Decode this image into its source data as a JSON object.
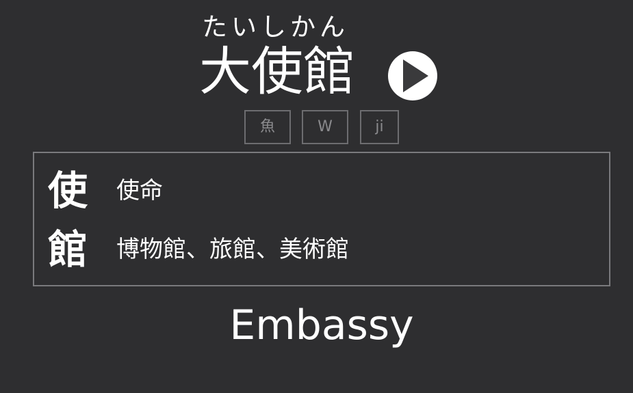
{
  "word": {
    "reading": "たいしかん",
    "kanji": "大使館"
  },
  "audio": {
    "icon": "play-icon"
  },
  "dictionary_buttons": [
    {
      "label": "魚"
    },
    {
      "label": "W"
    },
    {
      "label": "ji"
    }
  ],
  "kanji_breakdown": [
    {
      "character": "使",
      "examples": "使命"
    },
    {
      "character": "館",
      "examples": "博物館、旅館、美術館"
    }
  ],
  "meaning": "Embassy",
  "colors": {
    "background": "#2e2e30",
    "text": "#ffffff",
    "border": "#7a7a7d",
    "muted_button_text": "#8a8a8d"
  }
}
